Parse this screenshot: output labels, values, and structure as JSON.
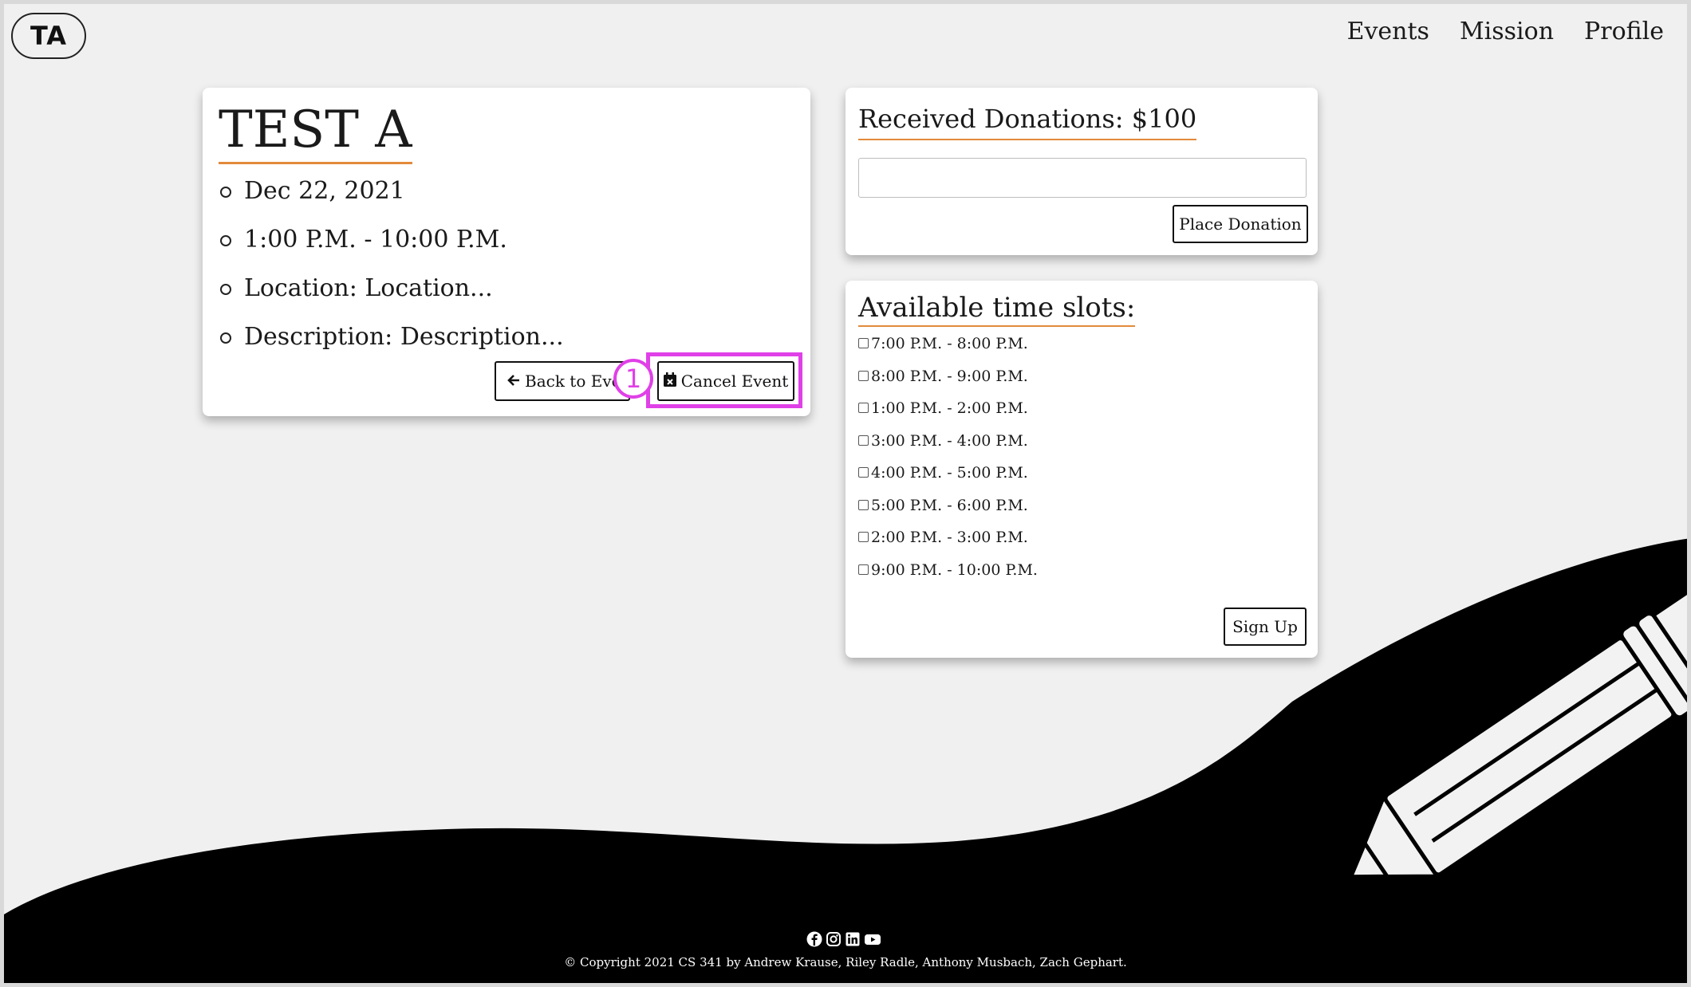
{
  "header": {
    "logo": "TA",
    "nav": [
      "Events",
      "Mission",
      "Profile"
    ]
  },
  "event": {
    "title": "TEST A",
    "date": "Dec 22, 2021",
    "time": "1:00 P.M. - 10:00 P.M.",
    "location": "Location: Location...",
    "description": "Description: Description...",
    "back_label": "Back to Events",
    "cancel_label": "Cancel Event"
  },
  "annotation": {
    "badge": "1"
  },
  "donations": {
    "title": "Received Donations: $100",
    "input_value": "",
    "button_label": "Place Donation"
  },
  "slots": {
    "title": "Available time slots:",
    "items": [
      "7:00 P.M. - 8:00 P.M.",
      "8:00 P.M. - 9:00 P.M.",
      "1:00 P.M. - 2:00 P.M.",
      "3:00 P.M. - 4:00 P.M.",
      "4:00 P.M. - 5:00 P.M.",
      "5:00 P.M. - 6:00 P.M.",
      "2:00 P.M. - 3:00 P.M.",
      "9:00 P.M. - 10:00 P.M."
    ],
    "checked": [
      false,
      false,
      false,
      false,
      false,
      false,
      false,
      false
    ],
    "button_label": "Sign Up"
  },
  "footer": {
    "copyright": "© Copyright 2021 CS 341 by Andrew Krause, Riley Radle, Anthony Musbach, Zach Gephart.",
    "social_icons": [
      "facebook-icon",
      "instagram-icon",
      "linkedin-icon",
      "youtube-icon"
    ]
  }
}
